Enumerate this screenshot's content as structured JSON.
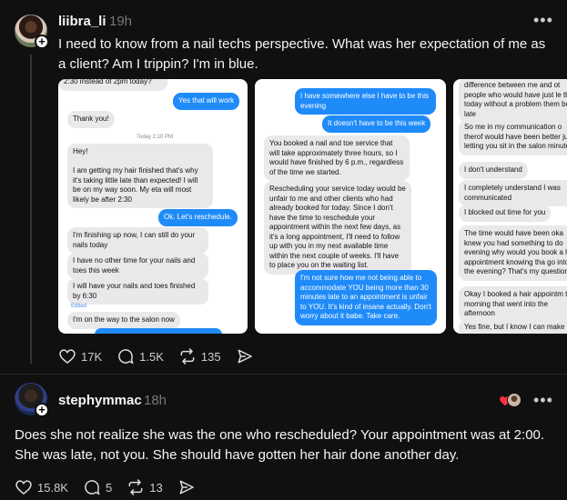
{
  "post1": {
    "username": "liibra_li",
    "time": "19h",
    "text": "I need to know from a nail techs perspective. What was her expectation of me as a client? Am I trippin? I'm in blue.",
    "likes": "17K",
    "replies": "1.5K",
    "reposts": "135",
    "image1": {
      "b1": "2:30 instead of 2pm today?",
      "b2": "Yes that will work",
      "b3": "Thank you!",
      "stamp": "Today 2:10 PM",
      "b4": "Hey!\n\nI am getting my hair finished that's why it's taking little late than expected! I will be on my way soon. My eta will most likely be after 2:30",
      "b5": "Ok. Let's reschedule.",
      "b6": "I'm finishing up now, I can still do your nails today",
      "b7": "I have no other time for your nails and toes this week",
      "b8": "I will have your nails and toes finished by 6:30",
      "edited": "Edited",
      "b9": "I'm on the way to the salon now"
    },
    "image2": {
      "b1": "I have somewhere else I have to be this evening",
      "b2": "It doesn't have to be this week",
      "b3": "You booked a nail and toe service that will take approximately three hours, so I would have finished by 6 p.m., regardless of the time we started.",
      "b4": "Rescheduling your service today would be unfair to me and other clients who had already booked for today. Since I don't have the time to reschedule your appointment within the next few days, as it's a long appointment, I'll need to follow up with you in my next available time within the next couple of weeks. I'll have to place you on the waiting list.",
      "b5": "I'm not sure how me not being able to accommodate YOU being more than 30 minutes late to an appointment is unfair to YOU. It's kind of insane actually. Don't worry about it babe. Take care."
    },
    "image3": {
      "b1": "difference between me and ot people who would have just le there today without a problem them being late",
      "b2": "So me in my communication o therof would have been better just letting you sit in the salon minutes",
      "b3": "I don't understand",
      "b4": "I completely understand I was communicated",
      "b5": "I blocked out time for you",
      "b6": "The time would have been oka knew you had something to do evening why would you book a hour appointment knowing tha go into the evening? That's my question.",
      "b7": "Okay I booked a hair appointm the morning that went into the afternoon",
      "b8": "Yes fine, but I know I can make"
    }
  },
  "post2": {
    "username": "stephymmac",
    "time": "18h",
    "text": "Does she not realize she was the one who rescheduled? Your appointment was at 2:00. She was late, not you. She should have gotten her hair done another day.",
    "likes": "15.8K",
    "replies": "5",
    "reposts": "13"
  },
  "icons": [
    "heart-icon",
    "comment-icon",
    "repost-icon",
    "share-icon",
    "more-icon",
    "plus-icon"
  ],
  "colors": {
    "background": "#101010",
    "bubble_blue": "#1f8bf9",
    "bubble_gray": "#e9e9eb",
    "heart_red": "#ff3040"
  }
}
